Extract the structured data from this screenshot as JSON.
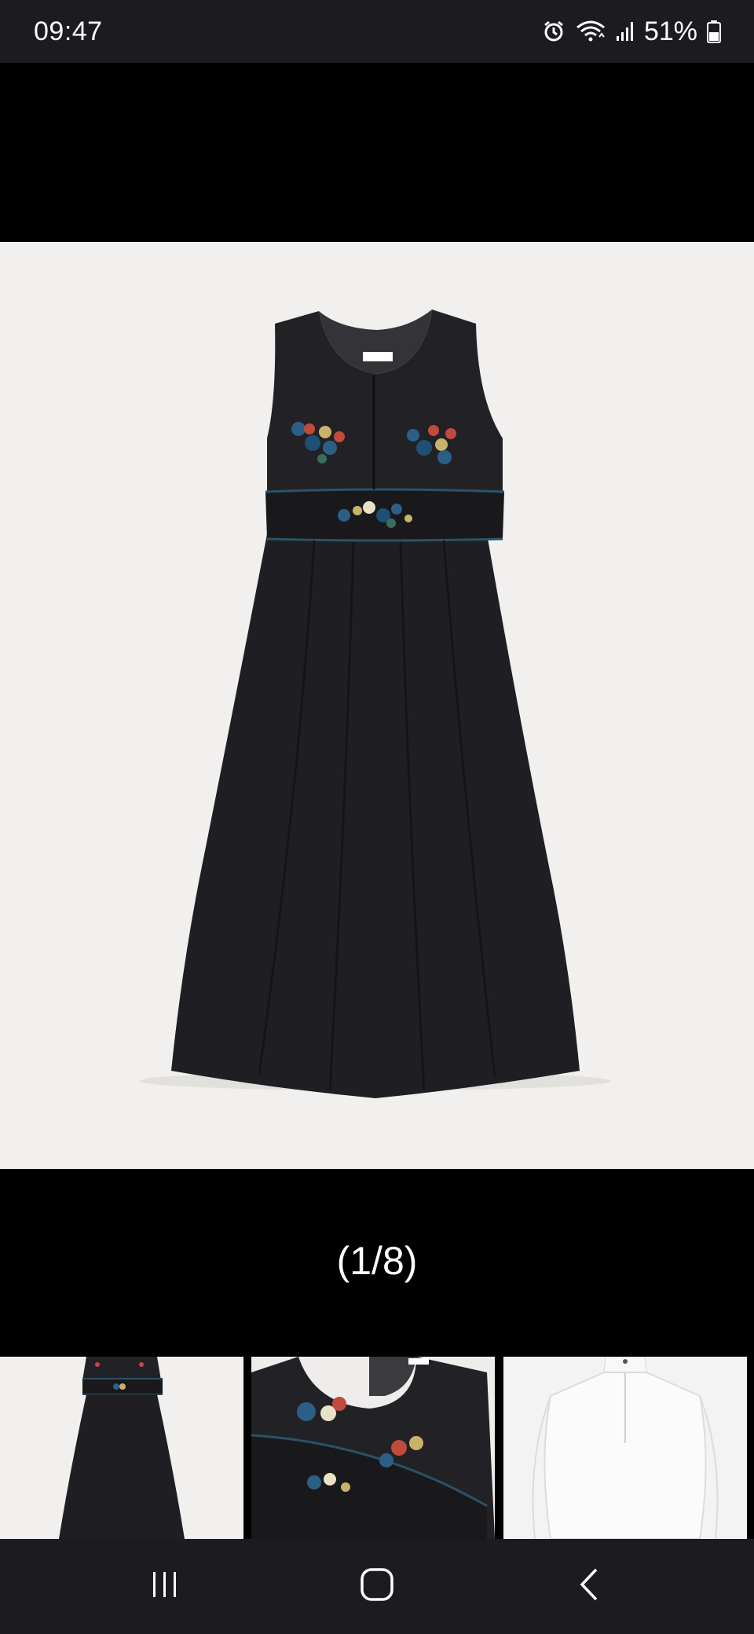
{
  "status_bar": {
    "time": "09:47",
    "battery_percent": "51%",
    "icons": [
      "alarm-icon",
      "wifi-icon",
      "signal-icon",
      "battery-icon"
    ]
  },
  "gallery": {
    "counter": "(1/8)",
    "current_index": 1,
    "total": 8,
    "main_image": "black-embroidered-pinafore-dress",
    "thumbnails": [
      {
        "image": "dress-full-view"
      },
      {
        "image": "dress-embroidery-closeup"
      },
      {
        "image": "white-shirt"
      }
    ]
  },
  "nav_bar": {
    "buttons": [
      "recent-apps-icon",
      "home-icon",
      "back-icon"
    ]
  }
}
